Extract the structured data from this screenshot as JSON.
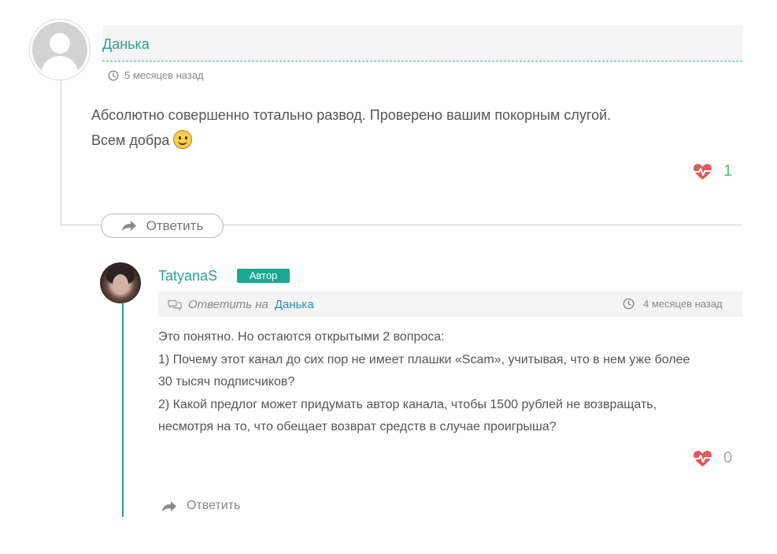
{
  "comment1": {
    "author": "Данька",
    "time": "5 месяцев назад",
    "text_line1": "Абсолютно совершенно тотально развод. Проверено вашим покорным слугой.",
    "text_line2": "Всем добра",
    "likes": "1",
    "reply_label": "Ответить",
    "icons": [
      "default-avatar-icon",
      "clock-icon",
      "smiley-icon",
      "heart-pulse-icon",
      "reply-arrow-icon"
    ]
  },
  "comment2": {
    "author": "TatyanaS",
    "badge": "Автор",
    "reply_to_label": "Ответить на",
    "reply_to_name": "Данька",
    "time": "4 месяцев назад",
    "lines": [
      "Это понятно. Но остаются открытыми 2 вопроса:",
      "1) Почему этот канал до сих пор не имеет плашки «Scam», учитывая, что в нем уже более",
      "30 тысяч подписчиков?",
      "2) Какой предлог может придумать автор канала, чтобы 1500 рублей не возвращать,",
      "несмотря на то, что обещает возврат средств в случае проигрыша?"
    ],
    "likes": "0",
    "reply_label": "Ответить",
    "icons": [
      "user-photo",
      "comments-icon",
      "clock-icon",
      "heart-pulse-icon",
      "reply-arrow-icon"
    ]
  },
  "colors": {
    "accent": "#2aa198",
    "badge": "#1aa893",
    "heart": "#e05a5a",
    "link": "#2a8fb8",
    "like_positive": "#4bc16b"
  }
}
